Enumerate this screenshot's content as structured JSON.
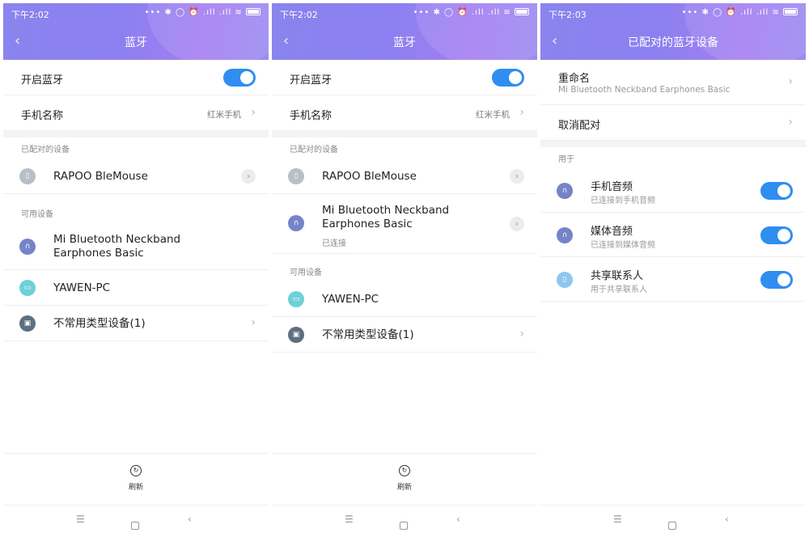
{
  "status": {
    "time1": "下午2:02",
    "time2": "下午2:02",
    "time3": "下午2:03",
    "icons": "••• ✱ ◯ ⏰ .ıll .ıll ≋"
  },
  "screen1": {
    "title": "蓝牙",
    "bt_toggle_label": "开启蓝牙",
    "bt_on": true,
    "phone_name_label": "手机名称",
    "phone_name_value": "红米手机",
    "paired_section": "已配对的设备",
    "paired": [
      {
        "name": "RAPOO BleMouse",
        "icon": "mouse-icon"
      }
    ],
    "available_section": "可用设备",
    "available": [
      {
        "name": "Mi Bluetooth Neckband Earphones Basic",
        "icon": "headphones-icon"
      },
      {
        "name": "YAWEN-PC",
        "icon": "computer-icon"
      },
      {
        "name": "不常用类型设备(1)",
        "icon": "generic-device-icon"
      }
    ],
    "refresh_label": "刷新"
  },
  "screen2": {
    "title": "蓝牙",
    "bt_toggle_label": "开启蓝牙",
    "bt_on": true,
    "phone_name_label": "手机名称",
    "phone_name_value": "红米手机",
    "paired_section": "已配对的设备",
    "paired": [
      {
        "name": "RAPOO BleMouse",
        "icon": "mouse-icon"
      },
      {
        "name": "Mi Bluetooth Neckband Earphones Basic",
        "sub": "已连接",
        "icon": "headphones-icon"
      }
    ],
    "available_section": "可用设备",
    "available": [
      {
        "name": "YAWEN-PC",
        "icon": "computer-icon"
      },
      {
        "name": "不常用类型设备(1)",
        "icon": "generic-device-icon"
      }
    ],
    "refresh_label": "刷新"
  },
  "screen3": {
    "title": "已配对的蓝牙设备",
    "rename_label": "重命名",
    "rename_value": "Mi Bluetooth Neckband Earphones Basic",
    "unpair_label": "取消配对",
    "use_section": "用于",
    "profiles": [
      {
        "name": "手机音频",
        "sub": "已连接到手机音频",
        "on": true,
        "icon": "headphones-icon"
      },
      {
        "name": "媒体音频",
        "sub": "已连接到媒体音频",
        "on": true,
        "icon": "headphones-icon"
      },
      {
        "name": "共享联系人",
        "sub": "用于共享联系人",
        "on": true,
        "icon": "phone-icon"
      }
    ]
  },
  "colors": {
    "header_start": "#8a84ee",
    "header_end": "#a47ef2",
    "toggle_on": "#2f8ef0"
  }
}
